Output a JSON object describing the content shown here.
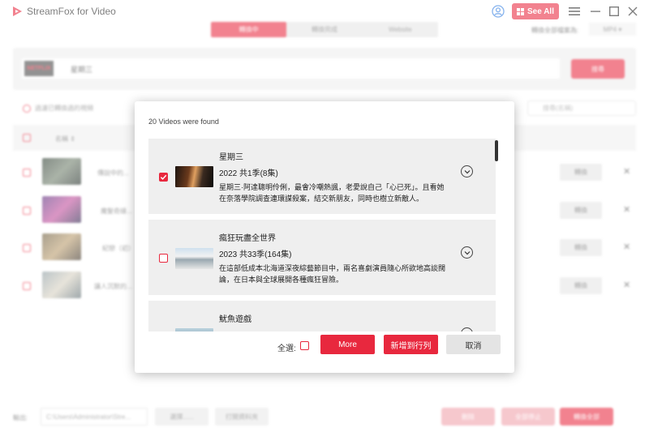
{
  "app": {
    "title": "StreamFox for Video",
    "see_all_label": "See All",
    "tabs": [
      {
        "label": "轉換中",
        "active": true
      },
      {
        "label": "轉換完成",
        "active": false
      },
      {
        "label": "Website",
        "active": false
      }
    ],
    "format_label": "轉換全部檔案為:",
    "format_value": "MP4 ▾",
    "search": {
      "service_logo": "NETFLIX",
      "query": "星期三",
      "button_label": "搜尋"
    },
    "info_text": "過濾已轉換過的視頻",
    "filter_placeholder": "搜尋(名稱)",
    "list_header_title": "名稱 ⇕",
    "bg_rows": [
      {
        "name": "傳說中的...",
        "button_label": "轉換"
      },
      {
        "name": "魔髮奇緣...",
        "button_label": "轉換"
      },
      {
        "name": "紀戀（初）",
        "button_label": "轉換"
      },
      {
        "name": "讓人沉默的...",
        "button_label": "轉換"
      }
    ],
    "bottom": {
      "output_label": "輸出:",
      "path": "C:\\Users\\Administrator\\Stre...",
      "browse_label": "選擇......",
      "open_folder_label": "打開資料夾",
      "delete_label": "刪除",
      "stop_all_label": "全部停止",
      "convert_all_label": "轉換全部"
    }
  },
  "modal": {
    "count_text": "20 Videos were found",
    "results": [
      {
        "title": "星期三",
        "meta": "2022 共1季(8集)",
        "desc_line1": "星期三·阿達聰明伶俐，最會冷嘲熱諷，老愛說自己「心已死」。且看她",
        "desc_line2": "在奈落學院調查連環謀殺案，結交新朋友，同時也樹立新敵人。",
        "checked": true
      },
      {
        "title": "瘋狂玩盡全世界",
        "meta": "2023 共33季(164集)",
        "desc_line1": "在這部低成本北海道深夜綜藝節目中，兩名喜劇演員隨心所欲地高談闊",
        "desc_line2": "論，在日本與全球展開各種瘋狂冒險。",
        "checked": false
      },
      {
        "title": "魷魚遊戲",
        "meta": "",
        "desc_line1": "",
        "desc_line2": "",
        "checked": false
      }
    ],
    "select_all_label": "全選:",
    "more_label": "More",
    "add_queue_label": "新增到行列",
    "cancel_label": "取消"
  },
  "colors": {
    "accent": "#e8283e",
    "card_bg": "#efefef"
  }
}
